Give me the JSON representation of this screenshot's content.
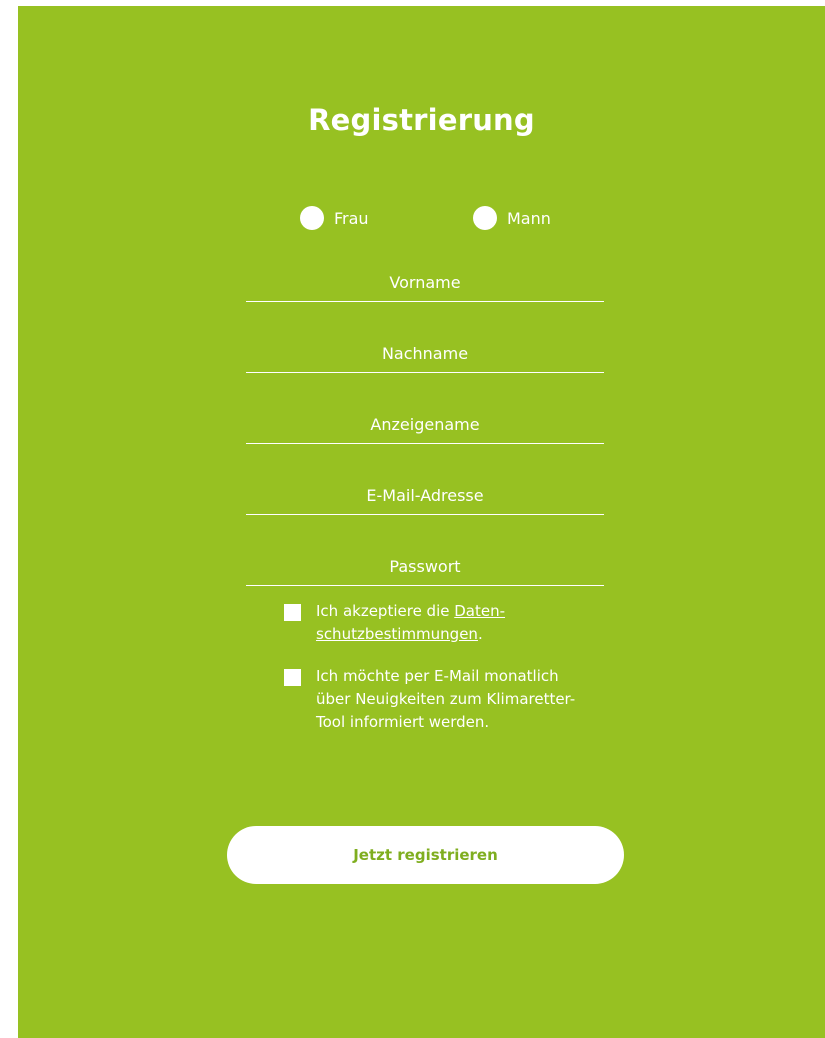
{
  "form": {
    "title": "Registrierung",
    "gender_options": {
      "frau": "Frau",
      "mann": "Mann"
    },
    "fields": {
      "vorname": {
        "placeholder": "Vorname",
        "value": ""
      },
      "nachname": {
        "placeholder": "Nachname",
        "value": ""
      },
      "anzeigename": {
        "placeholder": "Anzeigename",
        "value": ""
      },
      "email": {
        "placeholder": "E-Mail-Adresse",
        "value": ""
      },
      "passwort": {
        "placeholder": "Passwort",
        "value": ""
      }
    },
    "privacy": {
      "prefix": "Ich akzeptiere die ",
      "link": "Daten-schutzbestimmungen",
      "suffix": "."
    },
    "newsletter": {
      "text": "Ich möchte per E-Mail monatlich über Neuigkeiten zum Klimaretter-Tool informiert werden."
    },
    "submit_label": "Jetzt registrieren"
  },
  "colors": {
    "background": "#97c122",
    "text": "#ffffff",
    "button_text": "#7fae1f"
  },
  "icons": {
    "radio": "radio-circle-icon",
    "checkbox": "checkbox-square-icon"
  }
}
